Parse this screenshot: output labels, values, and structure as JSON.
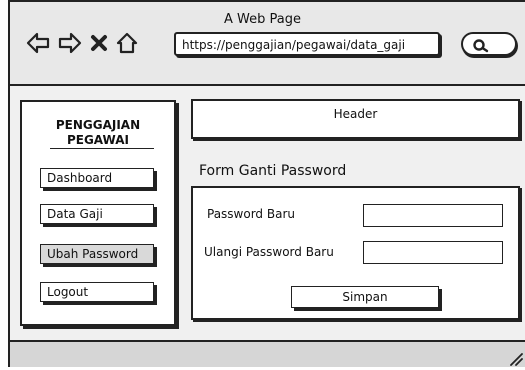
{
  "window": {
    "title": "A Web Page"
  },
  "browser": {
    "url": "https://penggajian/pegawai/data_gaji",
    "icons": [
      "back-arrow-icon",
      "forward-arrow-icon",
      "close-icon",
      "home-icon",
      "search-icon"
    ]
  },
  "sidebar": {
    "brand_line1": "PENGGAJIAN",
    "brand_line2": "PEGAWAI",
    "items": [
      {
        "label": "Dashboard",
        "active": false
      },
      {
        "label": "Data Gaji",
        "active": false
      },
      {
        "label": "Ubah Password",
        "active": true
      },
      {
        "label": "Logout",
        "active": false
      }
    ]
  },
  "header": {
    "label": "Header"
  },
  "form": {
    "title": "Form Ganti Password",
    "password_label": "Password Baru",
    "password_value": "",
    "confirm_label": "Ulangi Password Baru",
    "confirm_value": "",
    "submit_label": "Simpan"
  },
  "colors": {
    "topbar": "#e8e8e8",
    "content_bg": "#f0f0f0",
    "active_item": "#d9d9d9",
    "statusbar": "#d6d6d6"
  }
}
